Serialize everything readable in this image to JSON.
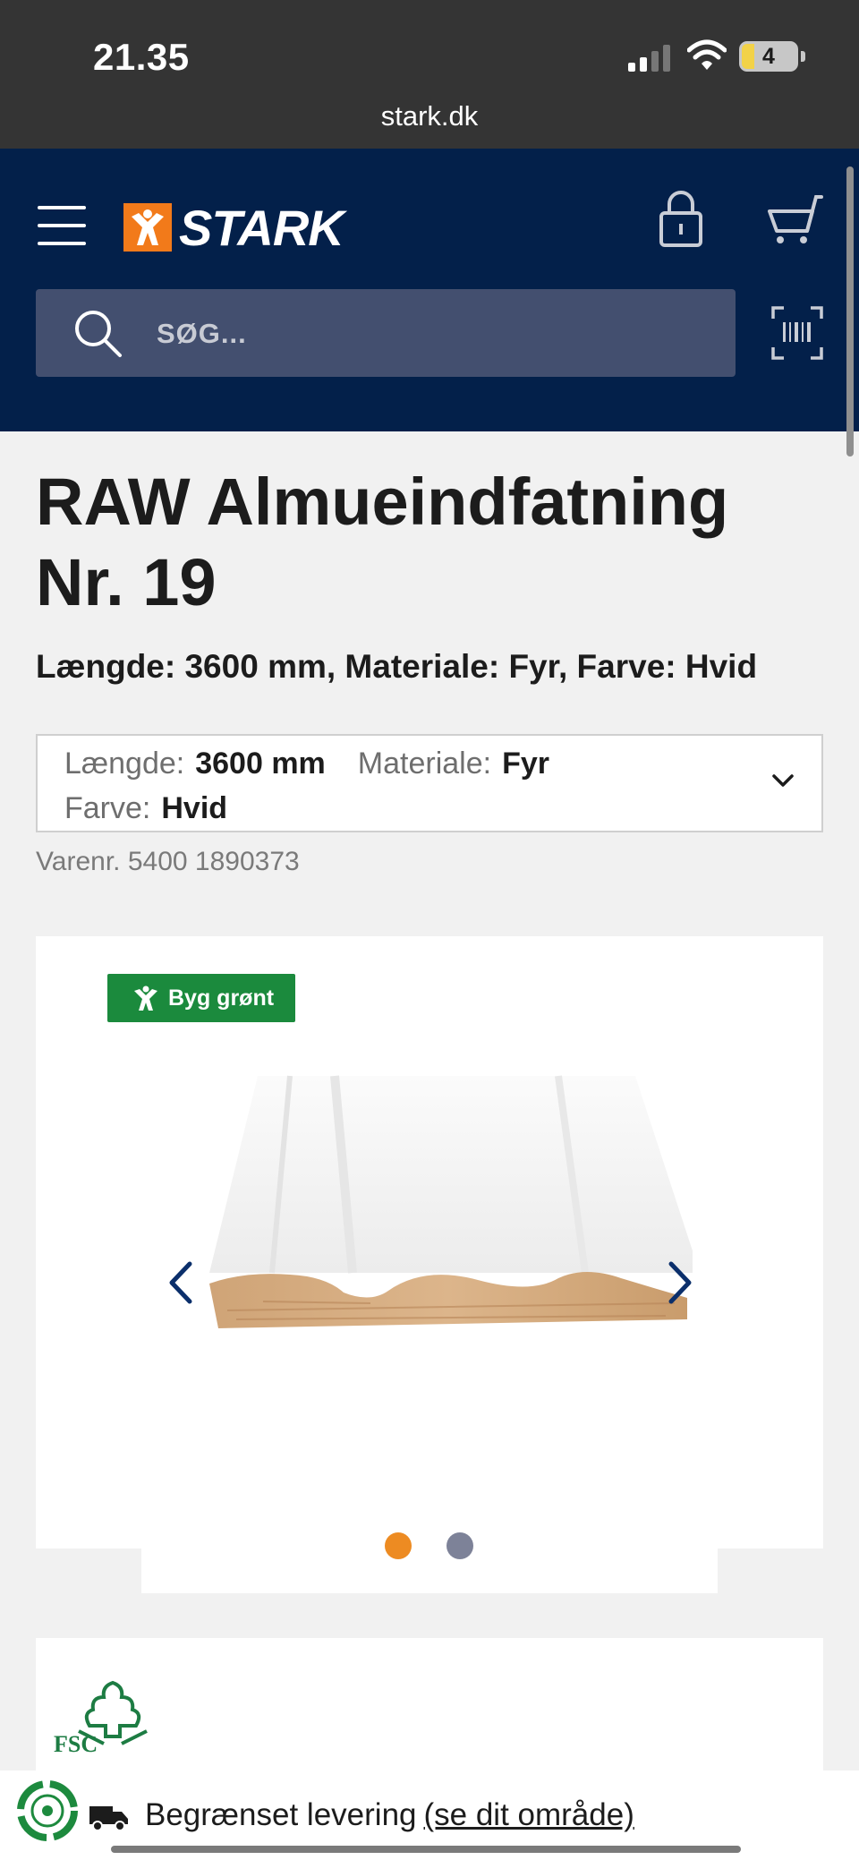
{
  "status_bar": {
    "time": "21.35",
    "url": "stark.dk",
    "battery": "4"
  },
  "header": {
    "logo_text": "STARK",
    "search_placeholder": "SØG...",
    "brand_color": "#03204a",
    "accent_color": "#f27a1a"
  },
  "product": {
    "title": "RAW Almueindfatning Nr. 19",
    "subtitle": "Længde: 3600 mm, Materiale: Fyr, Farve: Hvid",
    "variant": {
      "length_label": "Længde:",
      "length_value": "3600 mm",
      "material_label": "Materiale:",
      "material_value": "Fyr",
      "color_label": "Farve:",
      "color_value": "Hvid"
    },
    "sku": "Varenr. 5400 1890373",
    "badge": "Byg grønt",
    "badge_color": "#1b8a3d",
    "carousel": {
      "current": 1,
      "total": 2
    }
  },
  "certification": {
    "fsc_label": "FSC"
  },
  "delivery": {
    "text": "Begrænset levering",
    "link": "(se dit område)"
  }
}
